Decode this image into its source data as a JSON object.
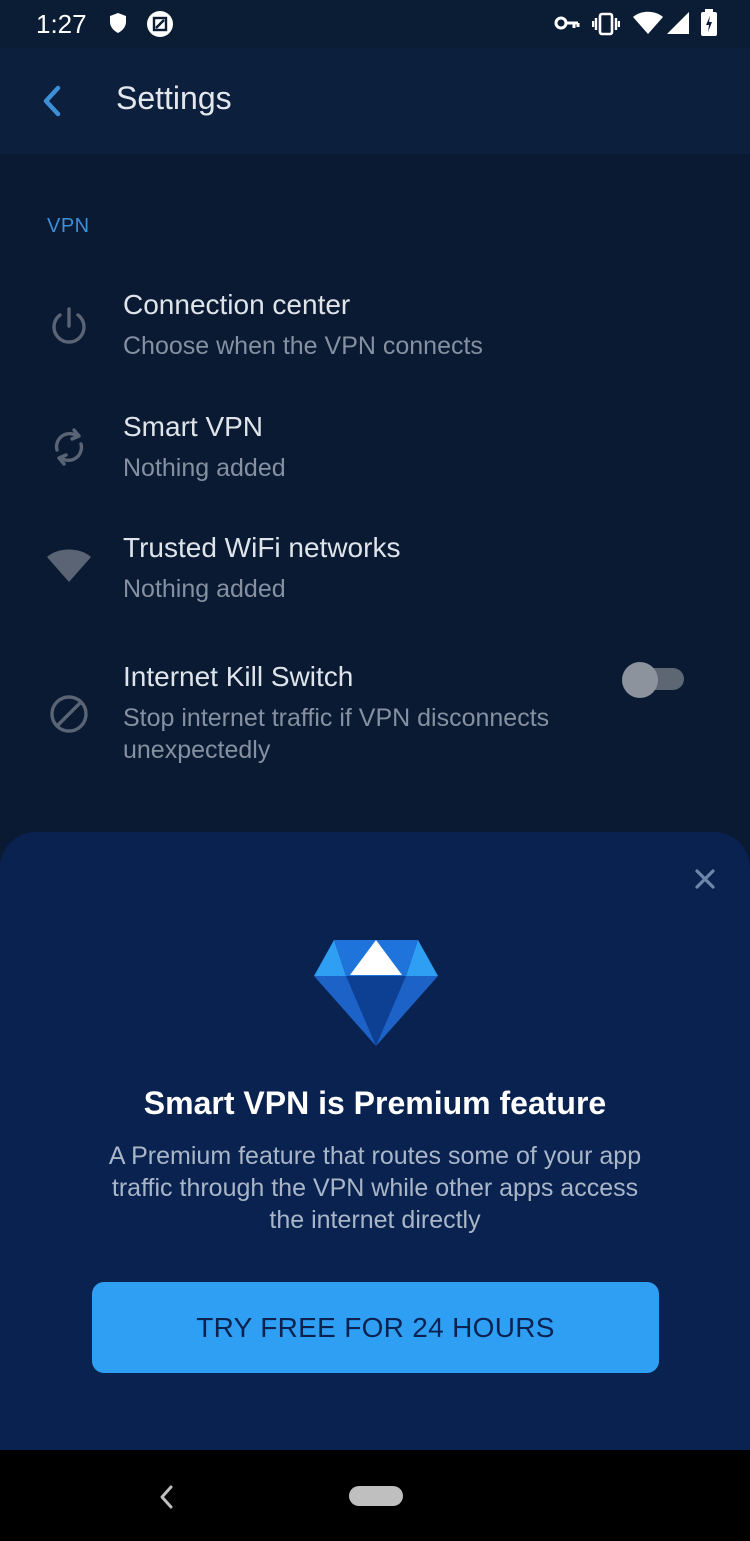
{
  "status_bar": {
    "time": "1:27",
    "icons": [
      "shield-icon",
      "screenshot-icon",
      "vpn-key-icon",
      "vibrate-icon",
      "wifi-icon",
      "signal-icon",
      "battery-icon"
    ]
  },
  "app_bar": {
    "back_icon": "chevron-left-icon",
    "title": "Settings"
  },
  "section": {
    "header": "VPN",
    "items": [
      {
        "icon": "power-icon",
        "title": "Connection center",
        "subtitle": "Choose when the VPN connects"
      },
      {
        "icon": "sync-icon",
        "title": "Smart VPN",
        "subtitle": "Nothing added"
      },
      {
        "icon": "wifi-icon",
        "title": "Trusted WiFi networks",
        "subtitle": "Nothing added"
      },
      {
        "icon": "block-icon",
        "title": "Internet Kill Switch",
        "subtitle": "Stop internet traffic if VPN disconnects unexpectedly",
        "toggle_on": false
      }
    ]
  },
  "premium_sheet": {
    "close_icon": "close-icon",
    "badge_icon": "diamond-icon",
    "title": "Smart VPN is Premium feature",
    "description": "A Premium feature that routes some of your app traffic through the VPN while other apps access the internet directly",
    "cta_label": "TRY FREE FOR 24 HOURS"
  },
  "colors": {
    "background": "#0a1a33",
    "accent": "#3d8fd6",
    "sheet": "#0a2250",
    "cta": "#2f9ff4"
  }
}
